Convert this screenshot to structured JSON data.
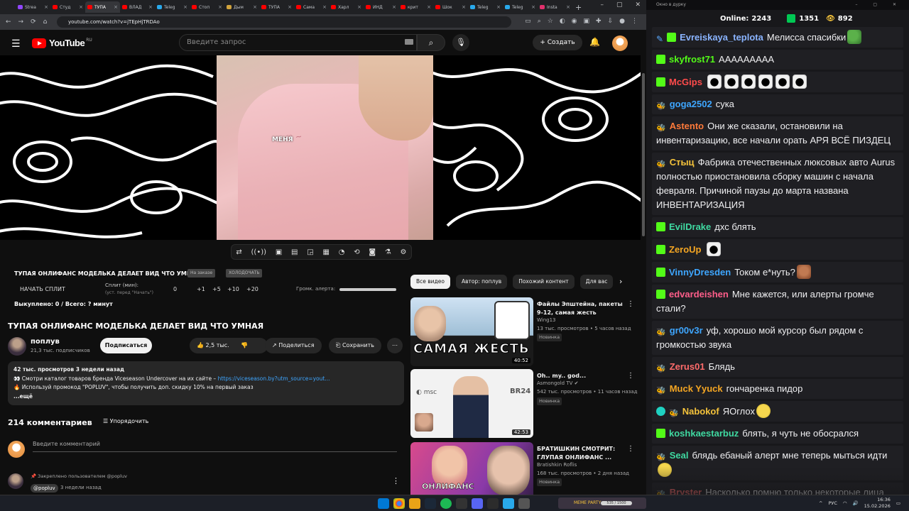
{
  "browser": {
    "tabs": [
      {
        "label": "Strea",
        "color": "#9146ff"
      },
      {
        "label": "Студ",
        "color": "#ff0000"
      },
      {
        "label": "ТУПА",
        "color": "#ff0000",
        "active": true
      },
      {
        "label": "ВЛАД",
        "color": "#ff0000"
      },
      {
        "label": "Teleg",
        "color": "#29a9eb"
      },
      {
        "label": "Стоп",
        "color": "#ff0000"
      },
      {
        "label": "Дым",
        "color": "#d1a33d"
      },
      {
        "label": "ТУПА",
        "color": "#ff0000"
      },
      {
        "label": "Сама",
        "color": "#ff0000"
      },
      {
        "label": "Харл",
        "color": "#ff0000"
      },
      {
        "label": "ИНД",
        "color": "#ff0000"
      },
      {
        "label": "крит",
        "color": "#ff0000"
      },
      {
        "label": "Шок",
        "color": "#ff0000"
      },
      {
        "label": "Teleg",
        "color": "#29a9eb"
      },
      {
        "label": "Teleg",
        "color": "#29a9eb"
      },
      {
        "label": "Insta",
        "color": "#e1306c"
      }
    ],
    "url": "youtube.com/watch?v=jTEpHjTRDAo"
  },
  "youtube": {
    "logo_word": "YouTube",
    "logo_region": "RU",
    "search_placeholder": "Введите запрос",
    "create_label": "Создать",
    "video_caption": "МЕНЯ",
    "overlay": {
      "title": "ТУПАЯ ОНЛИФАНС МОДЕЛЬКА ДЕЛАЕТ ВИД ЧТО УМНАЯ",
      "chip1": "На заказе",
      "chip2": "ХОЛОДОЧАТЬ",
      "start_split": "НАЧАТЬ СПЛИТ",
      "split_label": "Сплит (мин):",
      "split_sub": "(уст. перед \"Начать\")",
      "nums": [
        "0",
        "+1",
        "+5",
        "+10",
        "+20"
      ],
      "alert_label": "Громк. алерта:",
      "bought": "Выкуплено: 0 / Всего: ? минут"
    },
    "video_title": "ТУПАЯ ОНЛИФАНС МОДЕЛЬКА ДЕЛАЕТ ВИД ЧТО УМНАЯ",
    "channel": {
      "name": "поплув",
      "subs": "21,3 тыс. подписчиков"
    },
    "subscribe_label": "Подписаться",
    "likes": "2,5 тыс.",
    "share_label": "Поделиться",
    "save_label": "Сохранить",
    "desc": {
      "line1": "42 тыс. просмотров  3 недели назад",
      "line2_prefix": "👀 Смотри каталог товаров бренда Viceseason Undercover на их сайте – ",
      "line2_link": "https://viceseason.by?utm_source=yout...",
      "line3": "🔥 Используй промокод \"POPLUV\", чтобы получить доп. скидку 10% на первый заказ",
      "more": "...ещё"
    },
    "comments_count": "214 комментариев",
    "sort_label": "Упорядочить",
    "comment_placeholder": "Введите комментарий",
    "pinned_text": "Закреплено пользователем @popluv",
    "pinned_author": "@popluv",
    "pinned_time": "3 недели назад",
    "filters": [
      "Все видео",
      "Автор: поплув",
      "Похожий контент",
      "Для вас"
    ],
    "recs": [
      {
        "title": "Файлы Эпштейна, пакеты 9-12, самая жесть",
        "channel": "Wing13",
        "meta": "13 тыс. просмотров • 5 часов назад",
        "badge": "Новинка",
        "duration": "40:52",
        "thumb_text": "САМАЯ ЖЕСТЬ"
      },
      {
        "title": "Oh.. my.. god...",
        "channel": "Asmongold TV",
        "meta": "542 тыс. просмотров • 11 часов назад",
        "badge": "Новинка",
        "duration": "42:53",
        "thumb_text": "BR24"
      },
      {
        "title": "БРАТИШКИН СМОТРИТ: ГЛУПАЯ ОНЛИФАНС ...",
        "channel": "Bratishkin Roflis",
        "meta": "168 тыс. просмотров • 2 дня назад",
        "badge": "Новинка",
        "duration": "",
        "thumb_text": "ОНЛИФАНС"
      }
    ]
  },
  "chat": {
    "window_title": "Окно в дурку",
    "online_label": "Online:",
    "online": "2243",
    "twitch_count": "1351",
    "kick_count": "892",
    "messages": [
      {
        "badge": "pen",
        "name": "Evreiskaya_teplota",
        "color": "#8ab4ff",
        "text": "Мелисса спасибки",
        "emote": "pepe"
      },
      {
        "badge": "k",
        "name": "skyfrost71",
        "color": "#53fc18",
        "text": "AAAAAAAAA",
        "emote": ""
      },
      {
        "badge": "k",
        "name": "McGips",
        "color": "#ff4b4b",
        "text": "",
        "emote": "drop6"
      },
      {
        "badge": "kk",
        "name": "goga2502",
        "color": "#3ea6ff",
        "text": "сука",
        "emote": ""
      },
      {
        "badge": "kk",
        "name": "Astento",
        "color": "#ff7a3a",
        "text": "Они же сказали, остановили на инвентаризацию, все начали орать АРЯ ВСЁ ПИЗДЕЦ",
        "emote": ""
      },
      {
        "badge": "kk",
        "name": "Стыц",
        "color": "#f5c33b",
        "text": "Фабрика отечественных люксовых авто Aurus полностью приостановила сборку машин с начала февраля. Причиной паузы до марта названа ИНВЕНТАРИЗАЦИЯ",
        "emote": ""
      },
      {
        "badge": "k",
        "name": "EvilDrake",
        "color": "#3fd9a1",
        "text": "дхс блять",
        "emote": ""
      },
      {
        "badge": "k",
        "name": "ZeroUp",
        "color": "#f5a623",
        "text": "",
        "emote": "drop1"
      },
      {
        "badge": "k",
        "name": "VinnyDresden",
        "color": "#3ea6ff",
        "text": "Током е*нуть?",
        "emote": "face"
      },
      {
        "badge": "k",
        "name": "edvardeishen",
        "color": "#ff5e8a",
        "text": "Мне кажется, или алерты громче стали?",
        "emote": ""
      },
      {
        "badge": "kk",
        "name": "gr00v3r",
        "color": "#3ea6ff",
        "text": "уф, хорошо мой курсор был рядом с громкостью звука",
        "emote": ""
      },
      {
        "badge": "kk",
        "name": "Zerus01",
        "color": "#ff6b6b",
        "text": "Блядь",
        "emote": ""
      },
      {
        "badge": "kk",
        "name": "Muck Yyuck",
        "color": "#f5a623",
        "text": "гончаренка пидор",
        "emote": ""
      },
      {
        "badge": "twkk",
        "name": "Nabokof",
        "color": "#f5c33b",
        "text": "ЯОглох",
        "emote": "emoji"
      },
      {
        "badge": "k",
        "name": "koshkaestarbuz",
        "color": "#3fd9a1",
        "text": "блять, я чуть не обосрался",
        "emote": ""
      },
      {
        "badge": "kk",
        "name": "Seal",
        "color": "#3fd9a1",
        "text": "блядь ебаный алерт мне теперь мыться идти",
        "emote": "emoji"
      },
      {
        "badge": "kk",
        "name": "Bryster",
        "color": "#ff6b6b",
        "text": "Насколько помню только некоторые лица ездили на них",
        "emote": ""
      }
    ]
  },
  "taskbar": {
    "widget_label": "MEME PARTY",
    "widget_progress": "535 / 1500",
    "lang": "РУС",
    "time": "16:36",
    "date": "15.02.2026"
  }
}
